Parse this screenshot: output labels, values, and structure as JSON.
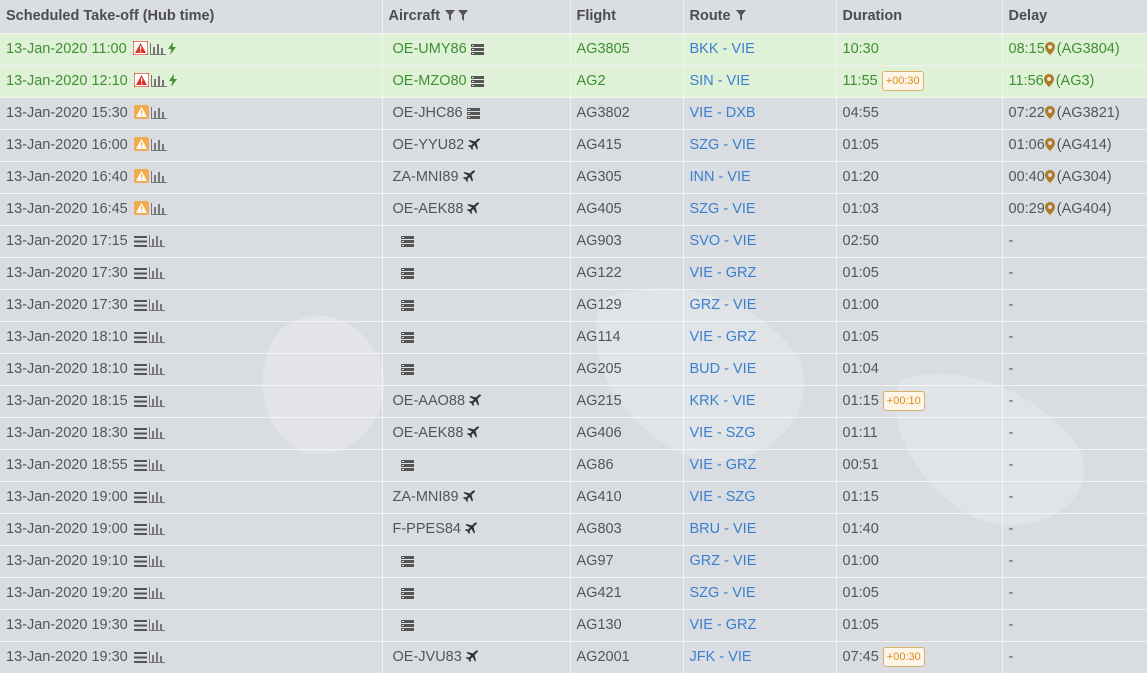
{
  "columns": [
    {
      "label": "Scheduled Take-off (Hub time)",
      "filters": 0
    },
    {
      "label": "Aircraft",
      "filters": 2
    },
    {
      "label": "Flight",
      "filters": 0
    },
    {
      "label": "Route",
      "filters": 1
    },
    {
      "label": "Duration",
      "filters": 0
    },
    {
      "label": "Delay",
      "filters": 0
    }
  ],
  "colors": {
    "active_bg": "#dff1d6",
    "active_text": "#3f8f33",
    "link": "#3a7fd0",
    "warn_red": "#d9342b",
    "warn_orange": "#f0ad4e",
    "badge": "#e08a1e"
  },
  "rows": [
    {
      "takeoff": "13-Jan-2020 11:00",
      "status": "warn-red",
      "bolt": true,
      "active": true,
      "aircraft": "OE-UMY86",
      "ac_icon": "list",
      "flight": "AG3805",
      "route": "BKK - VIE",
      "duration": "10:30",
      "badge": "",
      "delay": "08:15",
      "delay_ref": "(AG3804)"
    },
    {
      "takeoff": "13-Jan-2020 12:10",
      "status": "warn-red",
      "bolt": true,
      "active": true,
      "aircraft": "OE-MZO80",
      "ac_icon": "list",
      "flight": "AG2",
      "route": "SIN - VIE",
      "duration": "11:55",
      "badge": "+00:30",
      "delay": "11:56",
      "delay_ref": "(AG3)"
    },
    {
      "takeoff": "13-Jan-2020 15:30",
      "status": "warn-orange",
      "bolt": false,
      "active": false,
      "aircraft": "OE-JHC86",
      "ac_icon": "list",
      "flight": "AG3802",
      "route": "VIE - DXB",
      "duration": "04:55",
      "badge": "",
      "delay": "07:22",
      "delay_ref": "(AG3821)"
    },
    {
      "takeoff": "13-Jan-2020 16:00",
      "status": "warn-orange",
      "bolt": false,
      "active": false,
      "aircraft": "OE-YYU82",
      "ac_icon": "plane",
      "flight": "AG415",
      "route": "SZG - VIE",
      "duration": "01:05",
      "badge": "",
      "delay": "01:06",
      "delay_ref": "(AG414)"
    },
    {
      "takeoff": "13-Jan-2020 16:40",
      "status": "warn-orange",
      "bolt": false,
      "active": false,
      "aircraft": "ZA-MNI89",
      "ac_icon": "plane",
      "flight": "AG305",
      "route": "INN - VIE",
      "duration": "01:20",
      "badge": "",
      "delay": "00:40",
      "delay_ref": "(AG304)"
    },
    {
      "takeoff": "13-Jan-2020 16:45",
      "status": "warn-orange",
      "bolt": false,
      "active": false,
      "aircraft": "OE-AEK88",
      "ac_icon": "plane",
      "flight": "AG405",
      "route": "SZG - VIE",
      "duration": "01:03",
      "badge": "",
      "delay": "00:29",
      "delay_ref": "(AG404)"
    },
    {
      "takeoff": "13-Jan-2020 17:15",
      "status": "menu",
      "bolt": false,
      "active": false,
      "aircraft": "",
      "ac_icon": "list",
      "flight": "AG903",
      "route": "SVO - VIE",
      "duration": "02:50",
      "badge": "",
      "delay": "-",
      "delay_ref": ""
    },
    {
      "takeoff": "13-Jan-2020 17:30",
      "status": "menu",
      "bolt": false,
      "active": false,
      "aircraft": "",
      "ac_icon": "list",
      "flight": "AG122",
      "route": "VIE - GRZ",
      "duration": "01:05",
      "badge": "",
      "delay": "-",
      "delay_ref": ""
    },
    {
      "takeoff": "13-Jan-2020 17:30",
      "status": "menu",
      "bolt": false,
      "active": false,
      "aircraft": "",
      "ac_icon": "list",
      "flight": "AG129",
      "route": "GRZ - VIE",
      "duration": "01:00",
      "badge": "",
      "delay": "-",
      "delay_ref": ""
    },
    {
      "takeoff": "13-Jan-2020 18:10",
      "status": "menu",
      "bolt": false,
      "active": false,
      "aircraft": "",
      "ac_icon": "list",
      "flight": "AG114",
      "route": "VIE - GRZ",
      "duration": "01:05",
      "badge": "",
      "delay": "-",
      "delay_ref": ""
    },
    {
      "takeoff": "13-Jan-2020 18:10",
      "status": "menu",
      "bolt": false,
      "active": false,
      "aircraft": "",
      "ac_icon": "list",
      "flight": "AG205",
      "route": "BUD - VIE",
      "duration": "01:04",
      "badge": "",
      "delay": "-",
      "delay_ref": ""
    },
    {
      "takeoff": "13-Jan-2020 18:15",
      "status": "menu",
      "bolt": false,
      "active": false,
      "aircraft": "OE-AAO88",
      "ac_icon": "plane",
      "flight": "AG215",
      "route": "KRK - VIE",
      "duration": "01:15",
      "badge": "+00:10",
      "delay": "-",
      "delay_ref": ""
    },
    {
      "takeoff": "13-Jan-2020 18:30",
      "status": "menu",
      "bolt": false,
      "active": false,
      "aircraft": "OE-AEK88",
      "ac_icon": "plane",
      "flight": "AG406",
      "route": "VIE - SZG",
      "duration": "01:11",
      "badge": "",
      "delay": "-",
      "delay_ref": ""
    },
    {
      "takeoff": "13-Jan-2020 18:55",
      "status": "menu",
      "bolt": false,
      "active": false,
      "aircraft": "",
      "ac_icon": "list",
      "flight": "AG86",
      "route": "VIE - GRZ",
      "duration": "00:51",
      "badge": "",
      "delay": "-",
      "delay_ref": ""
    },
    {
      "takeoff": "13-Jan-2020 19:00",
      "status": "menu",
      "bolt": false,
      "active": false,
      "aircraft": "ZA-MNI89",
      "ac_icon": "plane",
      "flight": "AG410",
      "route": "VIE - SZG",
      "duration": "01:15",
      "badge": "",
      "delay": "-",
      "delay_ref": ""
    },
    {
      "takeoff": "13-Jan-2020 19:00",
      "status": "menu",
      "bolt": false,
      "active": false,
      "aircraft": "F-PPES84",
      "ac_icon": "plane",
      "flight": "AG803",
      "route": "BRU - VIE",
      "duration": "01:40",
      "badge": "",
      "delay": "-",
      "delay_ref": ""
    },
    {
      "takeoff": "13-Jan-2020 19:10",
      "status": "menu",
      "bolt": false,
      "active": false,
      "aircraft": "",
      "ac_icon": "list",
      "flight": "AG97",
      "route": "GRZ - VIE",
      "duration": "01:00",
      "badge": "",
      "delay": "-",
      "delay_ref": ""
    },
    {
      "takeoff": "13-Jan-2020 19:20",
      "status": "menu",
      "bolt": false,
      "active": false,
      "aircraft": "",
      "ac_icon": "list",
      "flight": "AG421",
      "route": "SZG - VIE",
      "duration": "01:05",
      "badge": "",
      "delay": "-",
      "delay_ref": ""
    },
    {
      "takeoff": "13-Jan-2020 19:30",
      "status": "menu",
      "bolt": false,
      "active": false,
      "aircraft": "",
      "ac_icon": "list",
      "flight": "AG130",
      "route": "VIE - GRZ",
      "duration": "01:05",
      "badge": "",
      "delay": "-",
      "delay_ref": ""
    },
    {
      "takeoff": "13-Jan-2020 19:30",
      "status": "menu",
      "bolt": false,
      "active": false,
      "aircraft": "OE-JVU83",
      "ac_icon": "plane",
      "flight": "AG2001",
      "route": "JFK - VIE",
      "duration": "07:45",
      "badge": "+00:30",
      "delay": "-",
      "delay_ref": ""
    }
  ]
}
